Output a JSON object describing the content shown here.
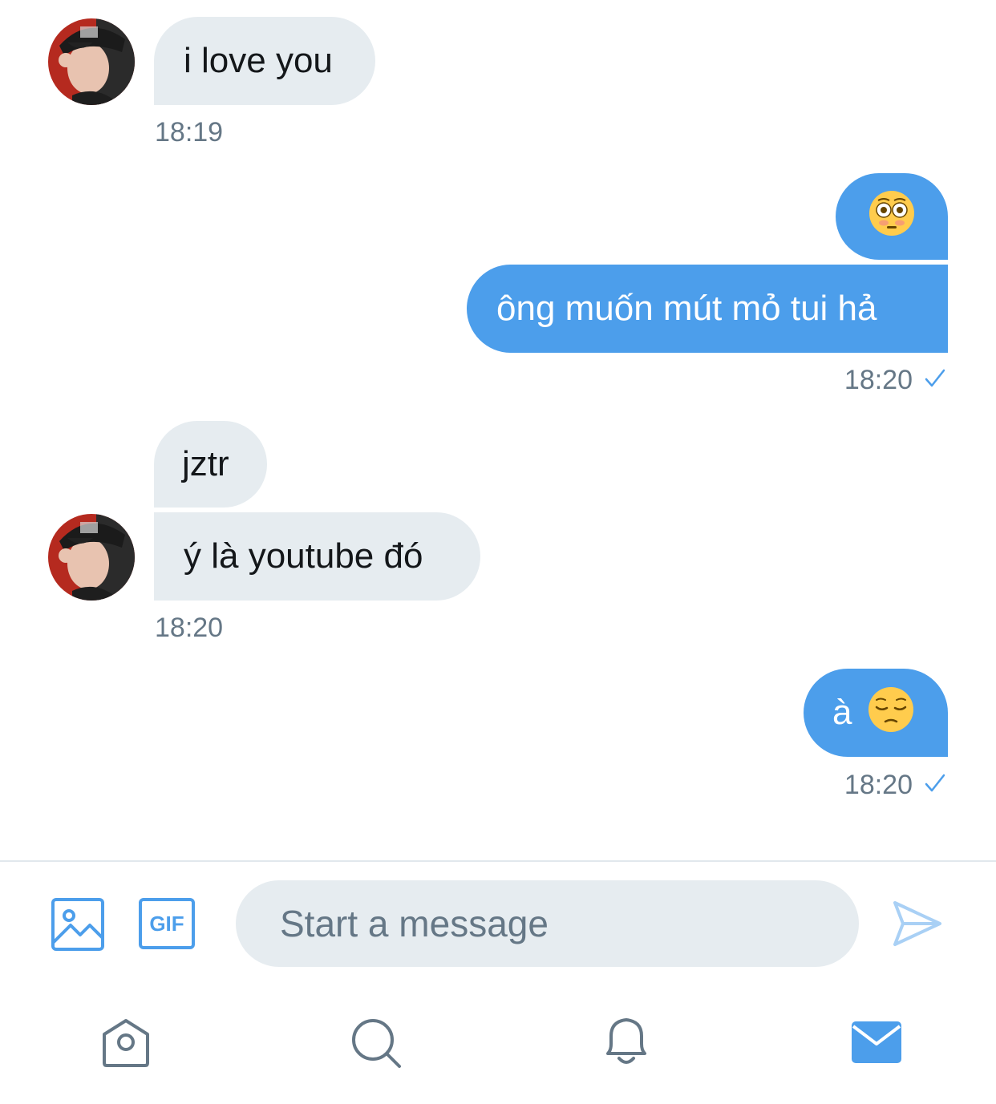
{
  "conversation": {
    "messages": [
      {
        "direction": "incoming",
        "text": "i love you"
      },
      {
        "direction": "outgoing",
        "emoji": "flushed-face-emoji"
      },
      {
        "direction": "outgoing",
        "text": "ông muốn mút mỏ tui hả"
      },
      {
        "direction": "incoming",
        "text": "jztr"
      },
      {
        "direction": "incoming",
        "text": "ý là youtube đó"
      },
      {
        "direction": "outgoing",
        "text": "à",
        "emoji": "pensive-face-emoji"
      }
    ],
    "timestamps": {
      "group1": "18:19",
      "group2": "18:20",
      "group3": "18:20",
      "group4": "18:20"
    }
  },
  "composer": {
    "placeholder": "Start a message",
    "media_icon": "image-icon",
    "gif_label": "GIF",
    "send_icon": "send-icon"
  },
  "tabbar": {
    "items": [
      "home-icon",
      "search-icon",
      "notifications-bell-icon",
      "messages-mail-icon"
    ],
    "active": "messages-mail-icon"
  },
  "colors": {
    "accent": "#4c9eeb",
    "incoming_bubble": "#e6ecf0",
    "muted_text": "#657786"
  }
}
